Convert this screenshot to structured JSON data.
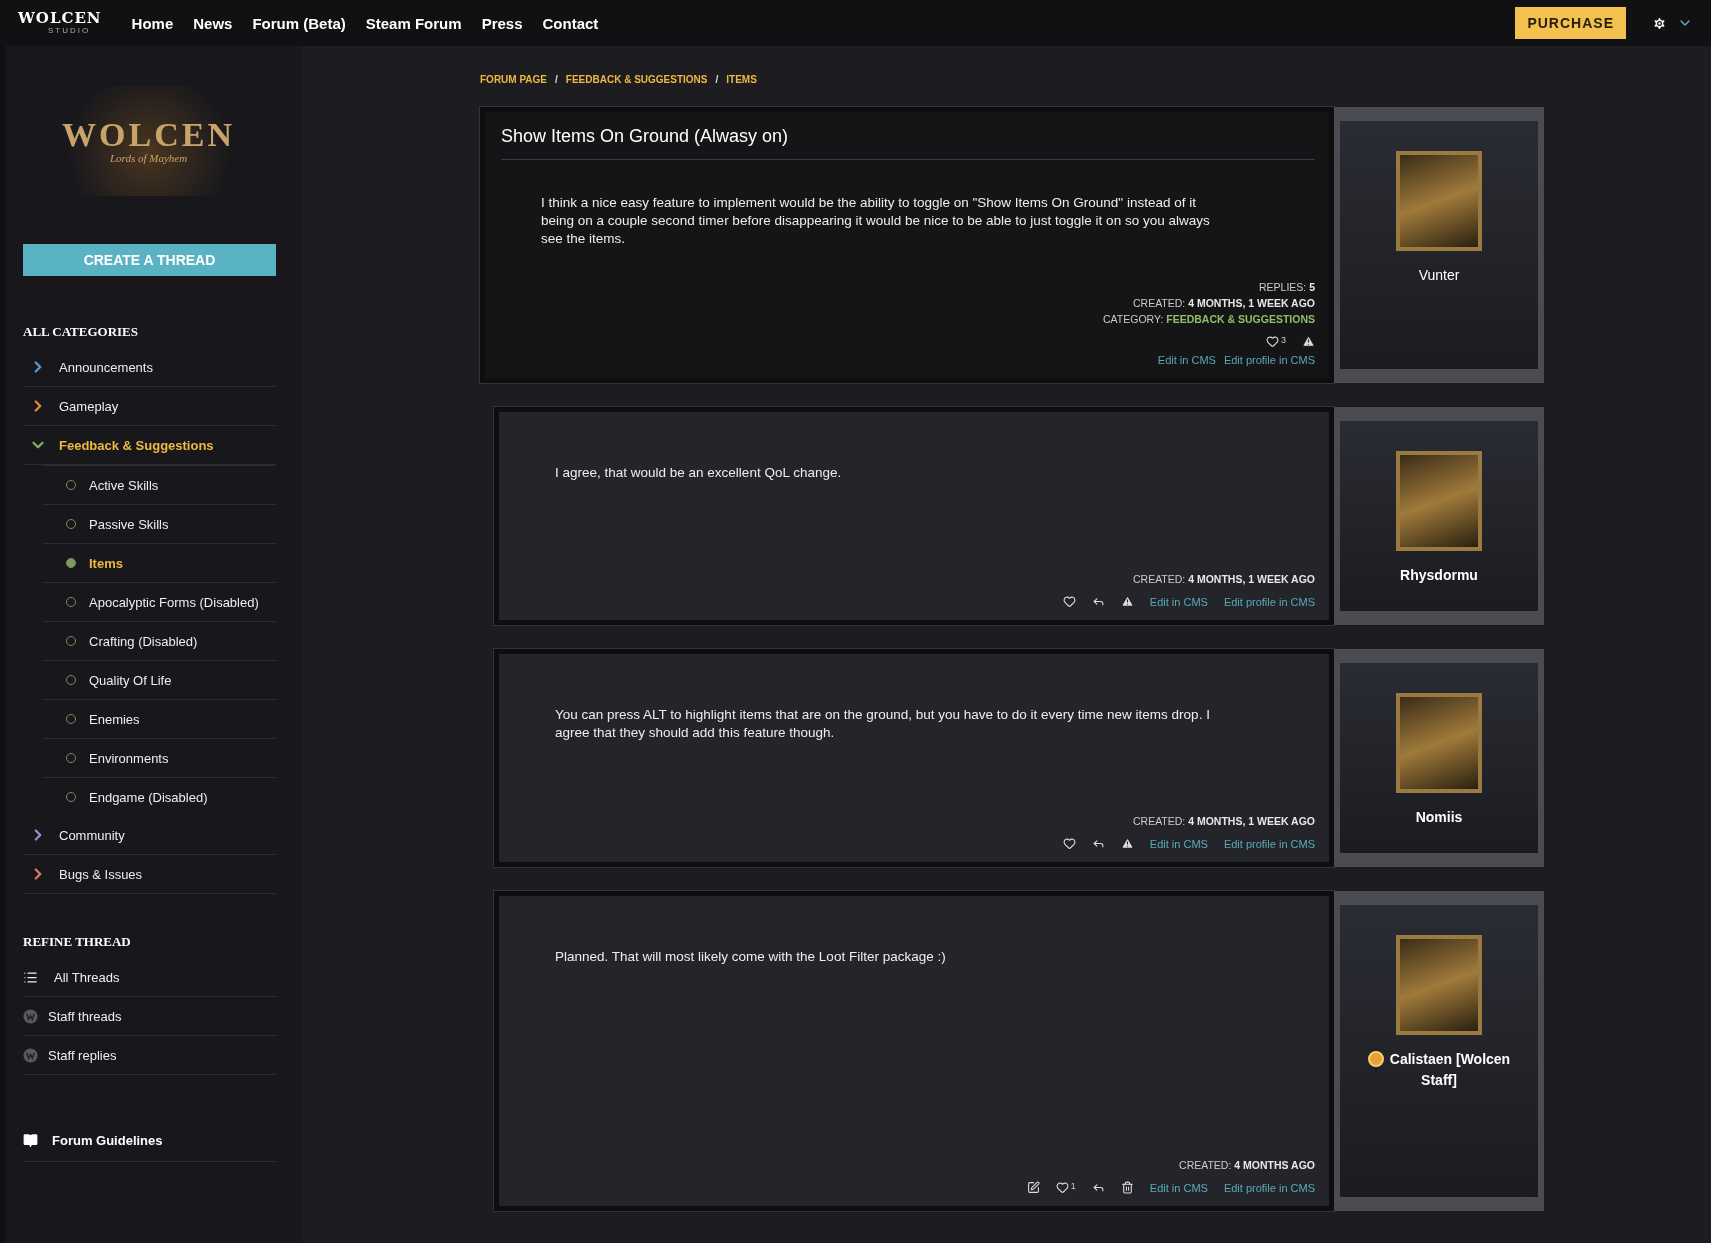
{
  "nav": {
    "logo": "WOLCEN",
    "logo_sub": "STUDIO",
    "links": [
      {
        "label": "Home"
      },
      {
        "label": "News"
      },
      {
        "label": "Forum (Beta)"
      },
      {
        "label": "Steam Forum"
      },
      {
        "label": "Press"
      },
      {
        "label": "Contact"
      }
    ],
    "purchase": "PURCHASE"
  },
  "sidebar": {
    "logo": "WOLCEN",
    "logo_sub": "Lords of Mayhem",
    "create_button": "CREATE A THREAD",
    "categories_heading": "ALL CATEGORIES",
    "categories": [
      {
        "label": "Announcements",
        "color": "#5b9bd5",
        "expanded": false,
        "selected": false
      },
      {
        "label": "Gameplay",
        "color": "#e38b3c",
        "expanded": false,
        "selected": false
      },
      {
        "label": "Feedback & Suggestions",
        "color": "#7fb069",
        "expanded": true,
        "selected": true,
        "children": [
          {
            "label": "Active Skills",
            "selected": false
          },
          {
            "label": "Passive Skills",
            "selected": false
          },
          {
            "label": "Items",
            "selected": true
          },
          {
            "label": "Apocalyptic Forms (Disabled)",
            "selected": false
          },
          {
            "label": "Crafting (Disabled)",
            "selected": false
          },
          {
            "label": "Quality Of Life",
            "selected": false
          },
          {
            "label": "Enemies",
            "selected": false
          },
          {
            "label": "Environments",
            "selected": false
          },
          {
            "label": "Endgame (Disabled)",
            "selected": false
          }
        ]
      },
      {
        "label": "Community",
        "color": "#9b8fd6",
        "expanded": false,
        "selected": false
      },
      {
        "label": "Bugs & Issues",
        "color": "#e07a6a",
        "expanded": false,
        "selected": false
      }
    ],
    "refine_heading": "REFINE THREAD",
    "refine": [
      {
        "label": "All Threads",
        "kind": "list"
      },
      {
        "label": "Staff threads",
        "kind": "staff"
      },
      {
        "label": "Staff replies",
        "kind": "staff"
      }
    ],
    "guidelines": "Forum Guidelines"
  },
  "breadcrumb": [
    {
      "kind": "link",
      "text": "FORUM PAGE"
    },
    {
      "kind": "separator",
      "text": "/"
    },
    {
      "kind": "link",
      "text": "FEEDBACK & SUGGESTIONS"
    },
    {
      "kind": "separator",
      "text": "/"
    },
    {
      "kind": "link",
      "text": "ITEMS"
    }
  ],
  "posts": [
    {
      "title": "Show Items On Ground (Alwasy on)",
      "body": "I think a nice easy feature to implement would be the ability to toggle on \"Show Items On Ground\" instead of it being on a couple second timer before disappearing it would be nice to be able to just toggle it on so you always see the items.",
      "replies_label": "REPLIES:",
      "replies": "5",
      "created_label": "CREATED:",
      "created": "4 MONTHS, 1 WEEK AGO",
      "category_label": "CATEGORY:",
      "category": "FEEDBACK & SUGGESTIONS",
      "actions": [
        {
          "kind": "like",
          "count": "3"
        },
        {
          "kind": "report"
        }
      ],
      "links": [
        "Edit in CMS",
        "Edit profile in CMS"
      ],
      "author": "Vunter",
      "author_bold": false,
      "staff": false
    },
    {
      "body": "I agree, that would be an excellent QoL change.",
      "created_label": "CREATED:",
      "created": "4 MONTHS, 1 WEEK AGO",
      "actions": [
        {
          "kind": "like"
        },
        {
          "kind": "reply"
        },
        {
          "kind": "report"
        }
      ],
      "links": [
        "Edit in CMS",
        "Edit profile in CMS"
      ],
      "author": "Rhysdormu",
      "author_bold": true,
      "staff": false
    },
    {
      "body": "You can press ALT to highlight items that are on the ground, but you have to do it every time new items drop. I agree that they should add this feature though.",
      "created_label": "CREATED:",
      "created": "4 MONTHS, 1 WEEK AGO",
      "actions": [
        {
          "kind": "like"
        },
        {
          "kind": "reply"
        },
        {
          "kind": "report"
        }
      ],
      "links": [
        "Edit in CMS",
        "Edit profile in CMS"
      ],
      "author": "Nomiis",
      "author_bold": true,
      "staff": false
    },
    {
      "body": "Planned. That will most likely come with the Loot Filter package :)",
      "created_label": "CREATED:",
      "created": "4 MONTHS AGO",
      "actions": [
        {
          "kind": "edit"
        },
        {
          "kind": "like",
          "count": "1"
        },
        {
          "kind": "reply"
        },
        {
          "kind": "delete"
        }
      ],
      "links": [
        "Edit in CMS",
        "Edit profile in CMS"
      ],
      "author": "Calistaen [Wolcen Staff]",
      "author_bold": true,
      "staff": true
    }
  ]
}
